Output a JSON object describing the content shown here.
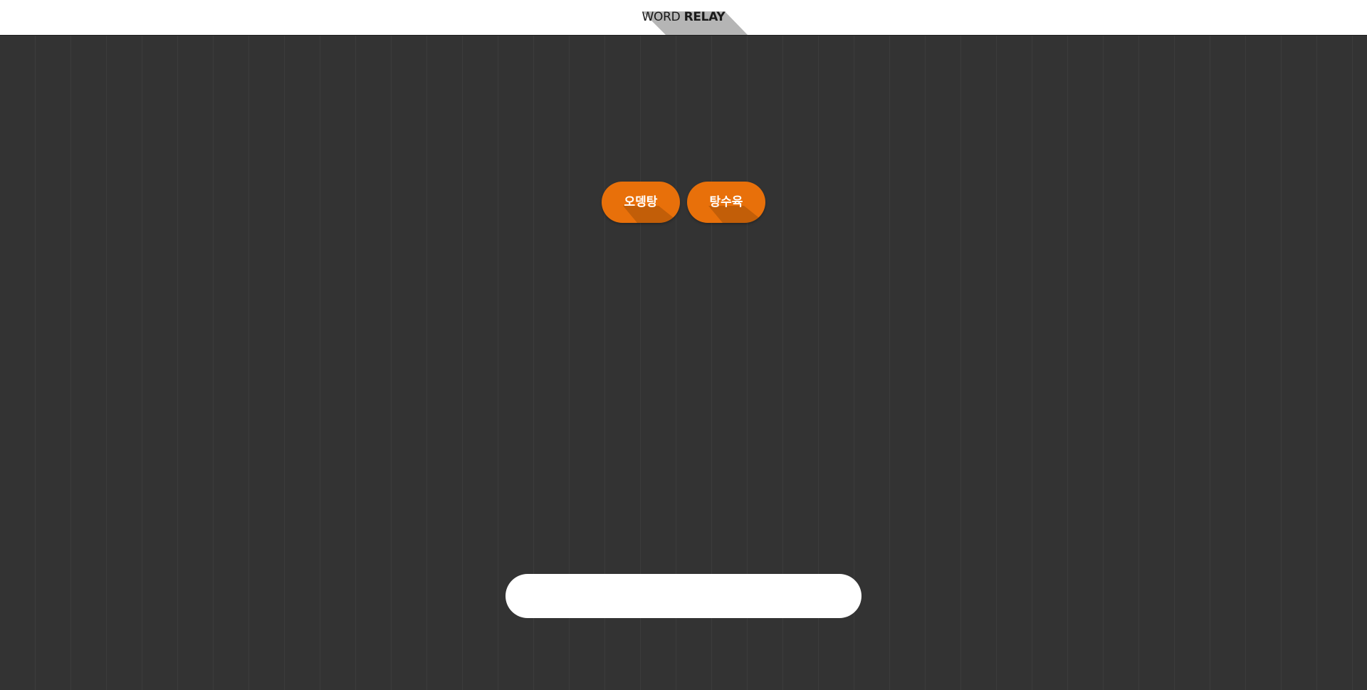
{
  "header": {
    "title_light": "WORD",
    "title_bold": "RELAY"
  },
  "words": [
    {
      "text": "오뎅탕"
    },
    {
      "text": "탕수육"
    }
  ],
  "input": {
    "value": "",
    "placeholder": ""
  },
  "colors": {
    "background": "#333333",
    "header_background": "#ffffff",
    "title_shadow": "#b5b5b5",
    "chip_background": "#e8700a",
    "chip_text": "#ffffff",
    "input_background": "#ffffff"
  }
}
